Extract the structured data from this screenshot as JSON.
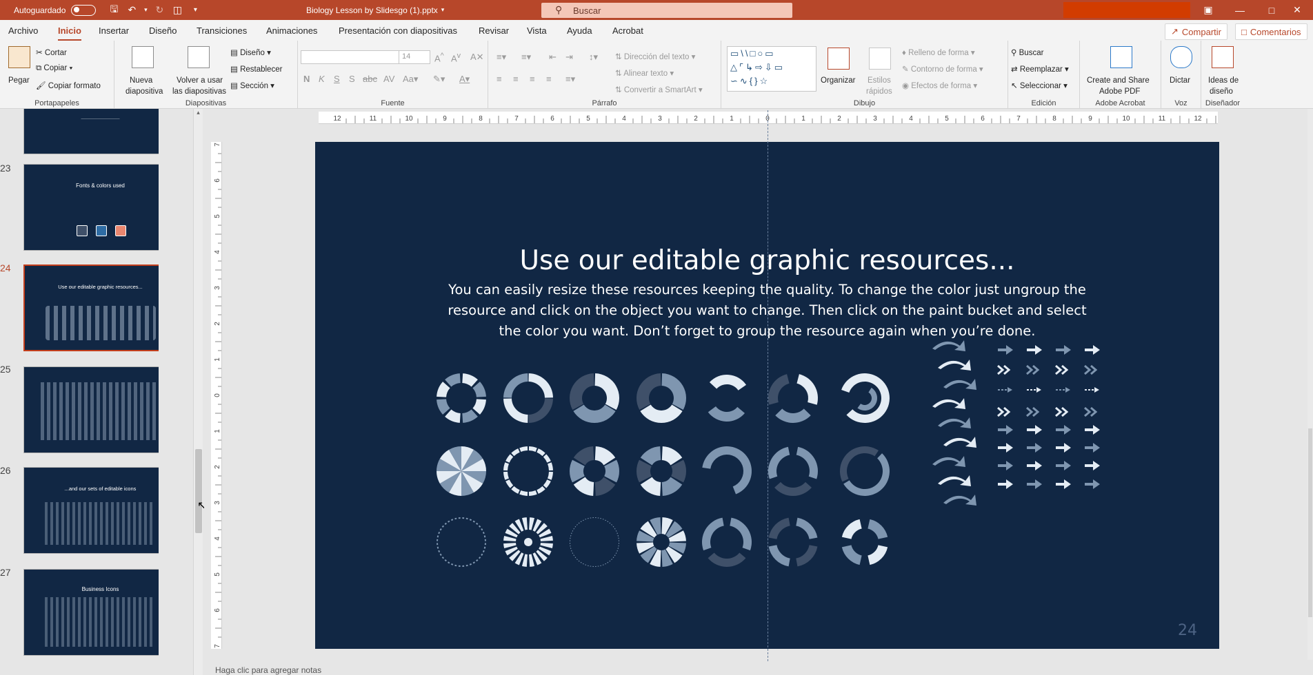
{
  "titlebar": {
    "autosave_label": "Autoguardado",
    "doc_title": "Biology Lesson by Slidesgo (1).pptx",
    "search_placeholder": "Buscar"
  },
  "menu": {
    "tabs": [
      "Archivo",
      "Inicio",
      "Insertar",
      "Diseño",
      "Transiciones",
      "Animaciones",
      "Presentación con diapositivas",
      "Revisar",
      "Vista",
      "Ayuda",
      "Acrobat"
    ],
    "share": "Compartir",
    "comments": "Comentarios"
  },
  "ribbon": {
    "portapapeles": {
      "label": "Portapapeles",
      "pegar": "Pegar",
      "cortar": "Cortar",
      "copiar": "Copiar",
      "copiar_formato": "Copiar formato"
    },
    "diapositivas": {
      "label": "Diapositivas",
      "nueva": "Nueva",
      "nueva2": "diapositiva",
      "volver": "Volver a usar",
      "volver2": "las diapositivas",
      "diseno": "Diseño",
      "restablecer": "Restablecer",
      "seccion": "Sección"
    },
    "fuente": {
      "label": "Fuente",
      "size": "14"
    },
    "parrafo": {
      "label": "Párrafo",
      "direccion": "Dirección del texto",
      "alinear": "Alinear texto",
      "convertir": "Convertir a SmartArt"
    },
    "dibujo": {
      "label": "Dibujo",
      "organizar": "Organizar",
      "estilos": "Estilos",
      "estilos2": "rápidos",
      "relleno": "Relleno de forma",
      "contorno": "Contorno de forma",
      "efectos": "Efectos de forma"
    },
    "edicion": {
      "label": "Edición",
      "buscar": "Buscar",
      "reemplazar": "Reemplazar",
      "seleccionar": "Seleccionar"
    },
    "acrobat": {
      "label": "Adobe Acrobat",
      "create": "Create and Share",
      "create2": "Adobe PDF"
    },
    "voz": {
      "label": "Voz",
      "dictar": "Dictar"
    },
    "disenador": {
      "label": "Diseñador",
      "ideas": "Ideas de",
      "ideas2": "diseño"
    }
  },
  "thumbnails": [
    {
      "num": "23",
      "title": "Fonts & colors used"
    },
    {
      "num": "24",
      "title": "Use our editable graphic resources..."
    },
    {
      "num": "25",
      "title": ""
    },
    {
      "num": "26",
      "title": "...and our sets of editable icons"
    },
    {
      "num": "27",
      "title": "Business Icons"
    }
  ],
  "slide": {
    "title": "Use our editable graphic resources...",
    "body": "You can easily resize these resources keeping the quality. To change the color just ungroup the resource and click on the object you want to change. Then click on the paint bucket and select the color you want. Don’t forget to group the resource again when you’re done.",
    "number": "24"
  },
  "ruler_labels": [
    "12",
    "11",
    "10",
    "9",
    "8",
    "7",
    "6",
    "5",
    "4",
    "3",
    "2",
    "1",
    "0",
    "1",
    "2",
    "3",
    "4",
    "5",
    "6",
    "7",
    "8",
    "9",
    "10",
    "11",
    "12"
  ],
  "notes_placeholder": "Haga clic para agregar notas",
  "colors": {
    "accent": "#b7472a",
    "slide_bg": "#112744",
    "shape_light": "#e4ecf4",
    "shape_mid": "#7f96b0",
    "shape_dark": "#3f5069"
  }
}
